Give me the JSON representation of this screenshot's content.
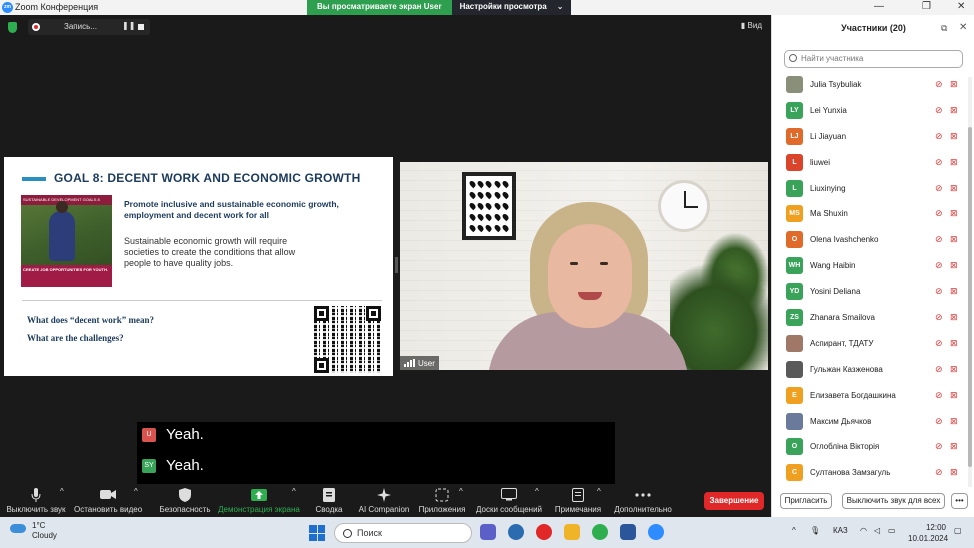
{
  "window": {
    "title": "Zoom Конференция",
    "logo": "zm"
  },
  "share_banner": {
    "viewing": "Вы просматриваете экран User",
    "settings": "Настройки просмотра"
  },
  "recording": {
    "label": "Запись..."
  },
  "view_button": "Вид",
  "slide": {
    "goal": "GOAL 8: DECENT WORK AND ECONOMIC GROWTH",
    "photo_header": "SUSTAINABLE DEVELOPMENT GOALS  8",
    "photo_footer": "CREATE JOB OPPORTUNITIES FOR YOUTH.",
    "promote": "Promote inclusive and sustainable economic growth, employment and decent work for all",
    "sustain": "Sustainable economic growth will require societies to create the conditions that allow people to have quality jobs.",
    "q1": "What does “decent work” mean?",
    "q2": "What are the challenges?"
  },
  "video": {
    "name": "User"
  },
  "captions": [
    {
      "initial": "U",
      "color": "#d9534f",
      "text": "Yeah."
    },
    {
      "initial": "SY",
      "color": "#3aa35a",
      "text": "Yeah."
    }
  ],
  "toolbar": {
    "mute": "Выключить звук",
    "video": "Остановить видео",
    "security": "Безопасность",
    "share": "Демонстрация экрана",
    "summary": "Сводка",
    "companion": "AI Companion",
    "apps": "Приложения",
    "whiteboards": "Доски сообщений",
    "notes": "Примечания",
    "more": "Дополнительно",
    "end": "Завершение"
  },
  "panel": {
    "title": "Участники (20)",
    "search_placeholder": "Найти участника",
    "invite": "Пригласить",
    "mute_all": "Выключить звук для всех",
    "more": "•••",
    "participants": [
      {
        "initials": "",
        "name": "Julia Tsybuliak",
        "color": "#8a8f7a",
        "photo": true
      },
      {
        "initials": "LY",
        "name": "Lei Yunxia",
        "color": "#3aa35a"
      },
      {
        "initials": "LJ",
        "name": "Li Jiayuan",
        "color": "#e06a2a"
      },
      {
        "initials": "L",
        "name": "liuwei",
        "color": "#d9442a"
      },
      {
        "initials": "L",
        "name": "Liuxinying",
        "color": "#3aa35a"
      },
      {
        "initials": "MS",
        "name": "Ma Shuxin",
        "color": "#f0a020"
      },
      {
        "initials": "O",
        "name": "Olena Ivashchenko",
        "color": "#e06a2a"
      },
      {
        "initials": "WH",
        "name": "Wang Haibin",
        "color": "#3aa35a"
      },
      {
        "initials": "YD",
        "name": "Yosini Deliana",
        "color": "#3aa35a"
      },
      {
        "initials": "ZS",
        "name": "Zhanara Smailova",
        "color": "#3aa35a"
      },
      {
        "initials": "",
        "name": "Аспирант, ТДАТУ",
        "color": "#a07868",
        "photo": true
      },
      {
        "initials": "",
        "name": "Гульжан Казженова",
        "color": "#5a5a5a",
        "photo": true
      },
      {
        "initials": "Е",
        "name": "Елизавета Богдашкина",
        "color": "#f0a020"
      },
      {
        "initials": "",
        "name": "Максим Дьячков",
        "color": "#6a7a9a",
        "photo": true
      },
      {
        "initials": "О",
        "name": "Оглоблiна Вiкторiя",
        "color": "#3aa35a"
      },
      {
        "initials": "С",
        "name": "Султанова Замзагуль",
        "color": "#f0a020"
      }
    ]
  },
  "taskbar": {
    "temperature": "1°C",
    "weather": "Cloudy",
    "search": "Поиск",
    "lang": "КАЗ",
    "time": "12:00",
    "date": "10.01.2024"
  }
}
